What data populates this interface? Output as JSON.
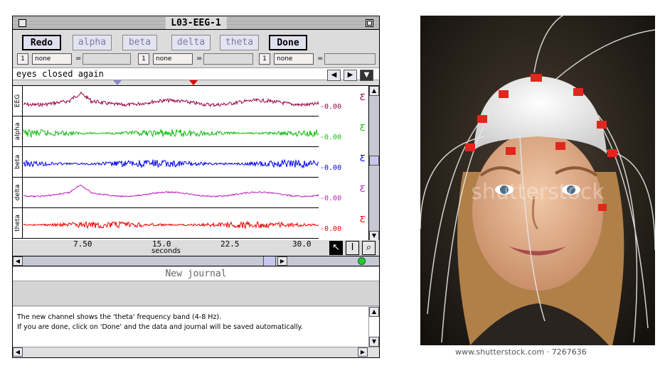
{
  "window": {
    "title": "L03-EEG-1"
  },
  "toolbar": {
    "buttons": [
      "Redo",
      "alpha",
      "beta",
      "delta",
      "theta",
      "Done"
    ]
  },
  "channels": [
    {
      "num": "1",
      "mode": "none",
      "eq": "="
    },
    {
      "num": "1",
      "mode": "none",
      "eq": "="
    },
    {
      "num": "1",
      "mode": "none",
      "eq": "="
    }
  ],
  "comment": {
    "text": "eyes closed again"
  },
  "traces": [
    {
      "label": "EEG",
      "value": "-0.00",
      "color": "#990044"
    },
    {
      "label": "alpha",
      "value": "-0.00",
      "color": "#11bb11"
    },
    {
      "label": "beta",
      "value": "-0.00",
      "color": "#0000ee"
    },
    {
      "label": "delta",
      "value": "-0.00",
      "color": "#bb22bb"
    },
    {
      "label": "theta",
      "value": "-0.00",
      "color": "#ee0000"
    }
  ],
  "axis": {
    "ticks": [
      "7.50",
      "15.0",
      "22.5",
      "30.0"
    ],
    "label": "seconds"
  },
  "journal": {
    "header": "New journal",
    "lines": [
      "The new channel shows the 'theta' frequency band (4-8 Hz).",
      "If you are done, click on 'Done' and the data and journal will be saved automatically."
    ]
  },
  "photo": {
    "watermark": "shutterstock",
    "credit": "www.shutterstock.com · 7267636"
  },
  "icons": {
    "close": "close-box-icon",
    "zoom": "zoom-box-icon",
    "nav_left": "left-arrow-icon",
    "nav_right": "right-arrow-icon",
    "nav_down": "down-arrow-icon",
    "pointer": "arrow-pointer-icon",
    "ibeam": "text-cursor-icon",
    "zoom_tool": "magnifier-icon"
  }
}
